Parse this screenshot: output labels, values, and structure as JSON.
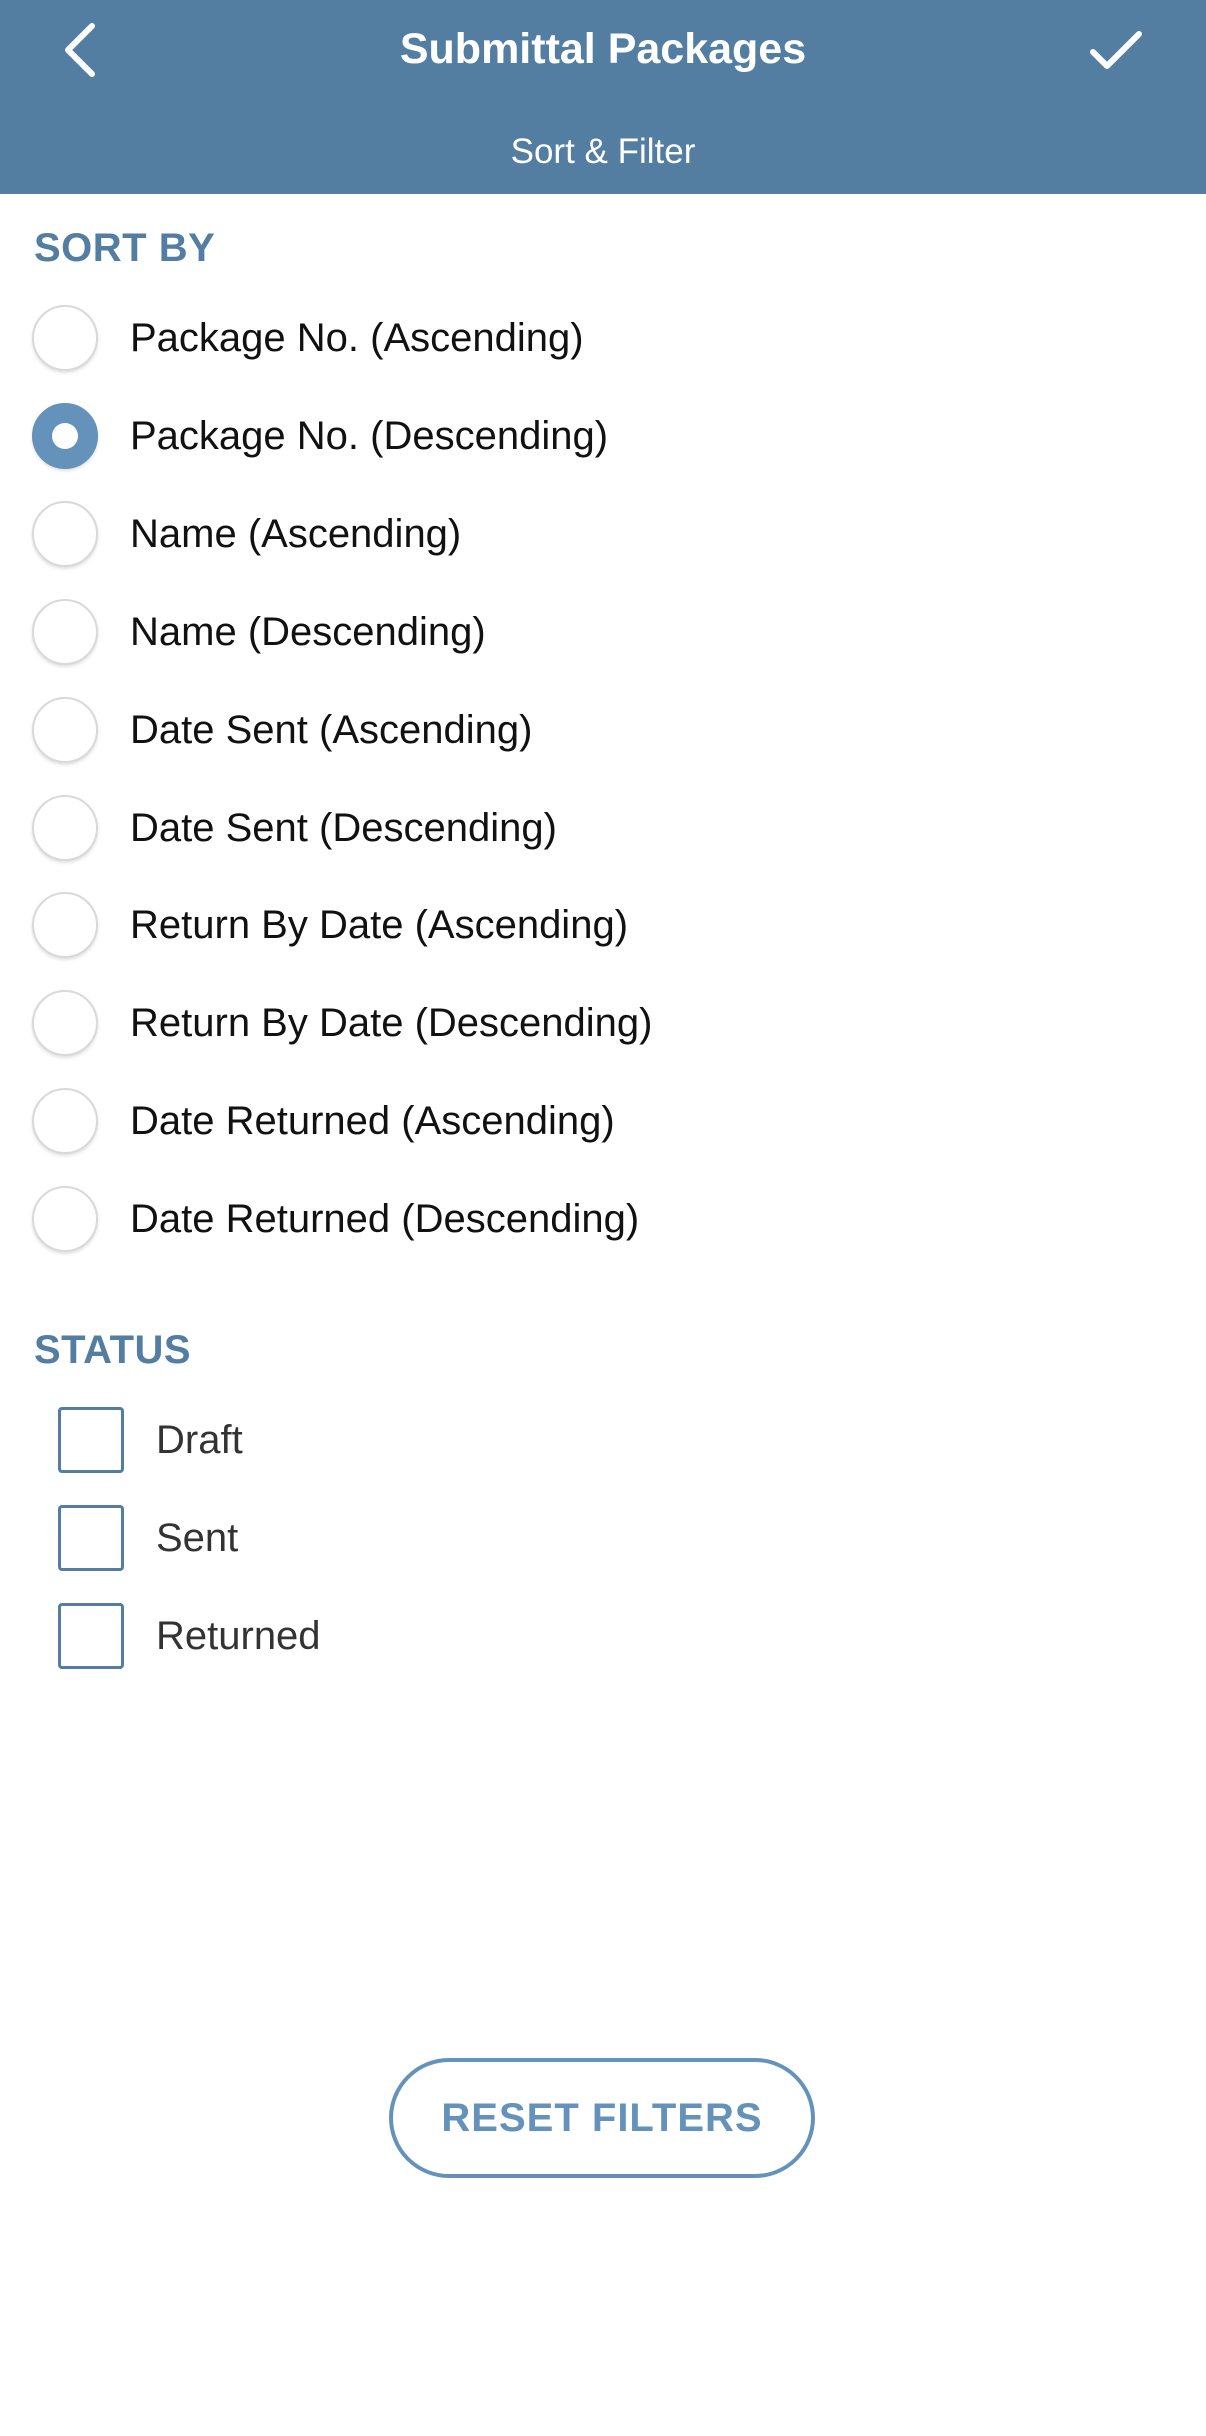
{
  "header": {
    "title": "Submittal Packages",
    "subtitle": "Sort & Filter",
    "back_icon": "chevron-left-icon",
    "done_icon": "checkmark-icon"
  },
  "sort": {
    "title": "SORT BY",
    "selected_index": 1,
    "options": [
      "Package No. (Ascending)",
      "Package No. (Descending)",
      "Name (Ascending)",
      "Name (Descending)",
      "Date Sent (Ascending)",
      "Date Sent (Descending)",
      "Return By Date (Ascending)",
      "Return By Date (Descending)",
      "Date Returned (Ascending)",
      "Date Returned (Descending)"
    ]
  },
  "status": {
    "title": "STATUS",
    "options": [
      {
        "label": "Draft",
        "checked": false
      },
      {
        "label": "Sent",
        "checked": false
      },
      {
        "label": "Returned",
        "checked": false
      }
    ]
  },
  "reset_button": "RESET FILTERS",
  "colors": {
    "header_bg": "#547ea1",
    "accent": "#6592ba",
    "section_title": "#547ea1"
  }
}
